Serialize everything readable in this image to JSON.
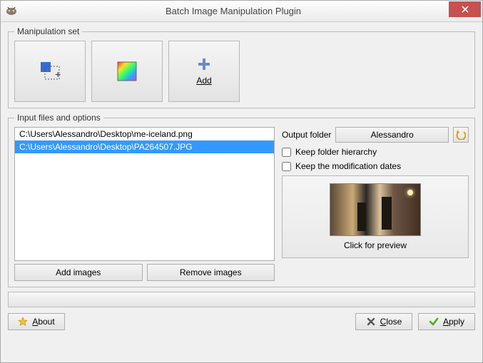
{
  "window": {
    "title": "Batch Image Manipulation Plugin"
  },
  "manipulation": {
    "legend": "Manipulation set",
    "crop_tool": "crop",
    "color_tool": "color",
    "add_label": "Add"
  },
  "io": {
    "legend": "Input files and options",
    "files": [
      "C:\\Users\\Alessandro\\Desktop\\me-iceland.png",
      "C:\\Users\\Alessandro\\Desktop\\PA264507.JPG"
    ],
    "selected_index": 1,
    "add_images": "Add images",
    "remove_images": "Remove images",
    "output_label": "Output folder",
    "output_folder": "Alessandro",
    "keep_hierarchy": "Keep folder hierarchy",
    "keep_dates": "Keep the modification dates",
    "preview_caption": "Click for preview"
  },
  "buttons": {
    "about": "About",
    "close": "Close",
    "apply": "Apply"
  }
}
